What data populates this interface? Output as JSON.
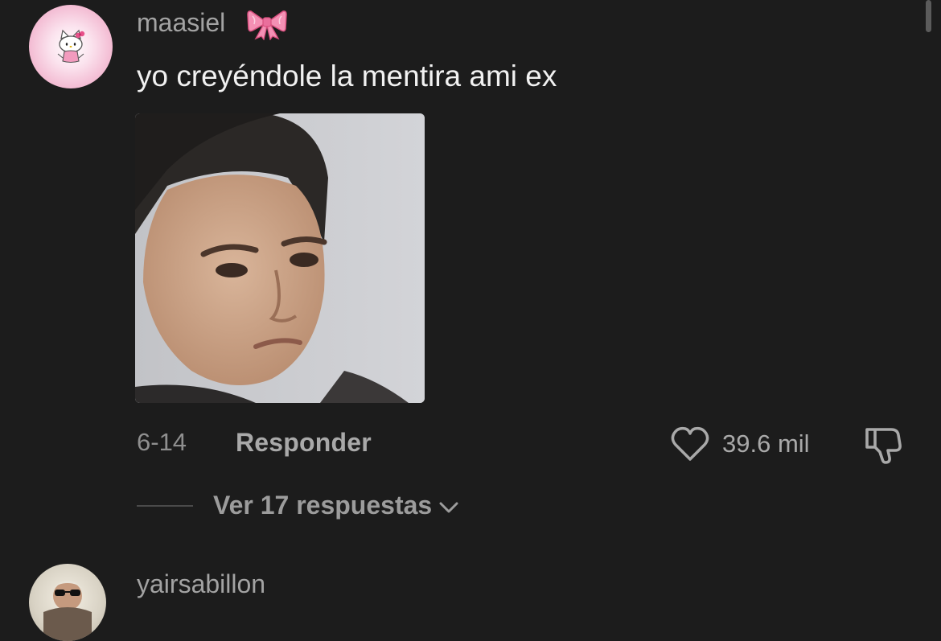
{
  "comment": {
    "username": "maasiel",
    "username_emoji": "ribbon-bow",
    "text": "yo creyéndole la mentira ami ex",
    "date": "6-14",
    "reply_label": "Responder",
    "like_count": "39.6 mil",
    "view_replies_label": "Ver 17 respuestas",
    "avatar": "hello-kitty-avatar",
    "image": "meme-face-photo"
  },
  "next_comment": {
    "username": "yairsabillon",
    "avatar": "sunglasses-person-avatar"
  },
  "colors": {
    "background": "#1c1c1c",
    "primary_text": "#f1f1f1",
    "secondary_text": "#a3a3a3",
    "bow_pink": "#f07fa8"
  }
}
